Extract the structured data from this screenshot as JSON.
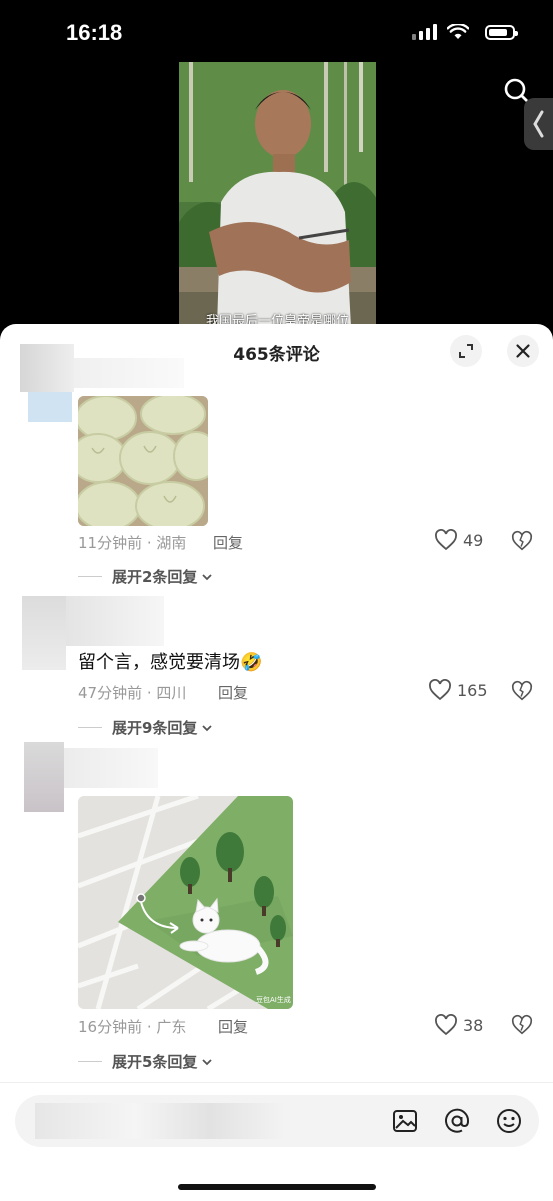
{
  "status_bar": {
    "time": "16:18"
  },
  "video": {
    "subtitle": "我国最后一位皇帝是哪位"
  },
  "comments_sheet": {
    "title": "465条评论",
    "comments": [
      {
        "time_location": "11分钟前 · 湖南",
        "reply_label": "回复",
        "likes": "49",
        "expand_label": "展开2条回复"
      },
      {
        "text": "留个言，感觉要清场",
        "emoji": "🤣",
        "time_location": "47分钟前 · 四川",
        "reply_label": "回复",
        "likes": "165",
        "expand_label": "展开9条回复"
      },
      {
        "time_location": "16分钟前 · 广东",
        "reply_label": "回复",
        "likes": "38",
        "expand_label": "展开5条回复",
        "image_watermark": "豆包AI生成"
      }
    ]
  },
  "bottom_bar": {
    "placeholder": ""
  },
  "colors": {
    "sheet_bg": "#ffffff",
    "map_green": "#7fae67",
    "text_primary": "#111111",
    "text_secondary": "#999999"
  }
}
